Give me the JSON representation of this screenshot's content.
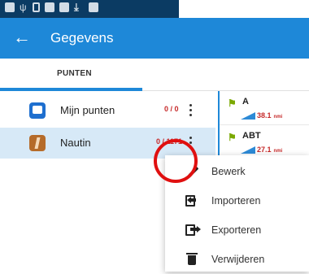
{
  "statusbar": {
    "icons": [
      "facebook-icon",
      "usb-icon",
      "image-icon",
      "mail-icon",
      "mail-icon",
      "download-icon",
      "mail-icon"
    ]
  },
  "appbar": {
    "title": "Gegevens",
    "back_icon": "arrow-left-icon"
  },
  "tabs": [
    {
      "label": "PUNTEN",
      "active": true
    }
  ],
  "lists": [
    {
      "name": "Mijn punten",
      "count": "0 / 0",
      "icon": "camera-icon",
      "selected": false
    },
    {
      "name": "Nautin",
      "count": "0 / 1171",
      "icon": "info-icon",
      "selected": true
    }
  ],
  "waypoints": [
    {
      "name": "A",
      "distance": "38.1",
      "unit": "nmi"
    },
    {
      "name": "ABT",
      "distance": "27.1",
      "unit": "nmi"
    }
  ],
  "menu": {
    "items": [
      {
        "label": "Bewerk",
        "icon": "pencil-icon"
      },
      {
        "label": "Importeren",
        "icon": "import-icon"
      },
      {
        "label": "Exporteren",
        "icon": "export-icon"
      },
      {
        "label": "Verwijderen",
        "icon": "trash-icon"
      }
    ]
  },
  "colors": {
    "appbar": "#1e88d8",
    "statusbar": "#0b3b63",
    "selected_row": "#d7e9f7",
    "count": "#c62828",
    "highlight": "#e01010"
  }
}
